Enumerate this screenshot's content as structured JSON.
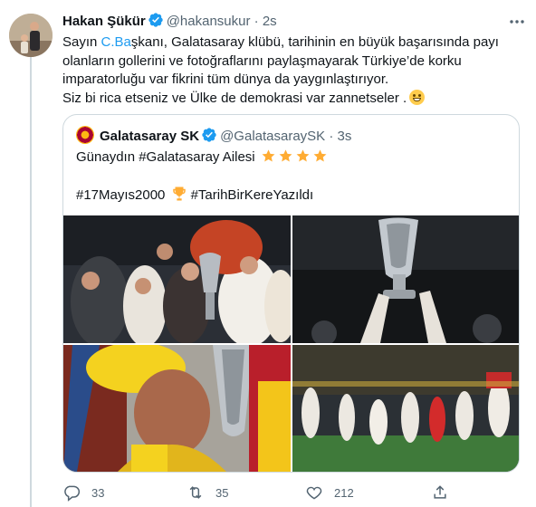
{
  "tweet": {
    "author_name": "Hakan Şükür",
    "handle": "@hakansukur",
    "time": "2s",
    "text_line1_pre": "Sayın ",
    "text_line1_mention": "C.Ba",
    "text_line1_post": "şkanı, Galatasaray klübü, tarihinin en büyük başarısında payı",
    "text_line2": "olanların gollerini ve  fotoğraflarını paylaşmayarak Türkiye’de korku",
    "text_line3": "imparatorluğu var fikrini tüm dünya da yaygınlaştırıyor.",
    "text_line4": "Siz bi rica etseniz ve Ülke de demokrasi var zannetseler ."
  },
  "quote": {
    "author_name": "Galatasaray SK",
    "handle": "@GalatasaraySK",
    "time": "3s",
    "text_line1": "Günaydın #Galatasaray Ailesi",
    "hashtag1": "#17Mayıs2000",
    "hashtag2": "#TarihBirKereYazıldı"
  },
  "actions": {
    "reply_count": "33",
    "retweet_count": "35",
    "like_count": "212"
  },
  "colors": {
    "accent": "#1d9bf0",
    "muted": "#536471",
    "border": "#cfd9de",
    "galatasaray_red": "#a90432",
    "galatasaray_yellow": "#fdb912"
  },
  "icons": [
    "verified-badge-icon",
    "more-options-icon",
    "star-emoji-icon",
    "trophy-emoji-icon",
    "grinning-emoji-icon",
    "reply-icon",
    "retweet-icon",
    "like-icon",
    "share-icon"
  ]
}
